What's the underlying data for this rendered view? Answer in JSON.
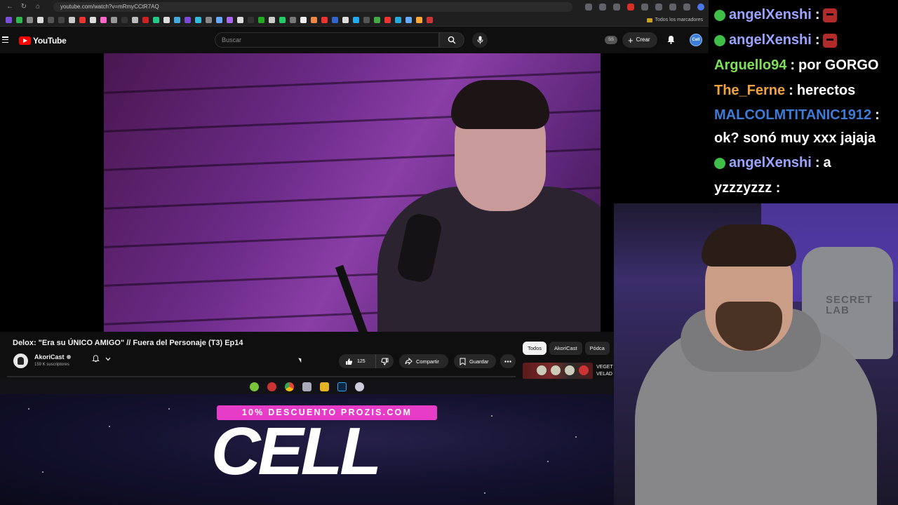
{
  "browser": {
    "url": "youtube.com/watch?v=mRmyCCtR7AQ",
    "bookmarks_folder": "Todos los marcadores"
  },
  "header": {
    "logo_text": "YouTube",
    "search_placeholder": "Buscar",
    "ss_badge": "SS",
    "create_label": "Crear",
    "avatar_text": "Cell"
  },
  "video": {
    "title": "Delox: \"Era su ÚNICO AMIGO\" // Fuera del Personaje (T3) Ep14",
    "channel_name": "AkoriCast",
    "subscribers": "159 K suscriptores",
    "likes": "125",
    "share_label": "Compartir",
    "save_label": "Guardar"
  },
  "sidebar": {
    "chips": [
      {
        "label": "Todos",
        "active": true
      },
      {
        "label": "AkoriCast",
        "active": false
      },
      {
        "label": "Pódca",
        "active": false
      }
    ],
    "rec_title_1": "VEGET",
    "rec_title_2": "VELAD"
  },
  "promo": {
    "banner": "10% DESCUENTO PROZIS.COM",
    "code": "CELL"
  },
  "chat": {
    "messages": [
      {
        "user": "angelXenshi",
        "text": "",
        "color": "#9aa4ff",
        "badge": true,
        "emote": true
      },
      {
        "user": "angelXenshi",
        "text": "",
        "color": "#9aa4ff",
        "badge": true,
        "emote": true
      },
      {
        "user": "Arguello94",
        "text": "por GORGO",
        "color": "#7ee05a",
        "badge": false,
        "emote": false
      },
      {
        "user": "The_Ferne",
        "text": "herectos",
        "color": "#f0a23c",
        "badge": false,
        "emote": false
      },
      {
        "user": "MALCOLMTITANIC1912",
        "text": "",
        "color": "#3e7bd6",
        "badge": false,
        "emote": false
      },
      {
        "user": "",
        "text": "ok? sonó muy xxx jajaja",
        "color": "#ffffff",
        "badge": false,
        "emote": false
      },
      {
        "user": "angelXenshi",
        "text": "a",
        "color": "#9aa4ff",
        "badge": true,
        "emote": false
      },
      {
        "user": "",
        "text": "yzzzyzzz :",
        "color": "#ffffff",
        "badge": false,
        "emote": false
      }
    ],
    "separator": " : "
  },
  "webcam": {
    "chair_brand_1": "SECRET",
    "chair_brand_2": "LAB"
  }
}
